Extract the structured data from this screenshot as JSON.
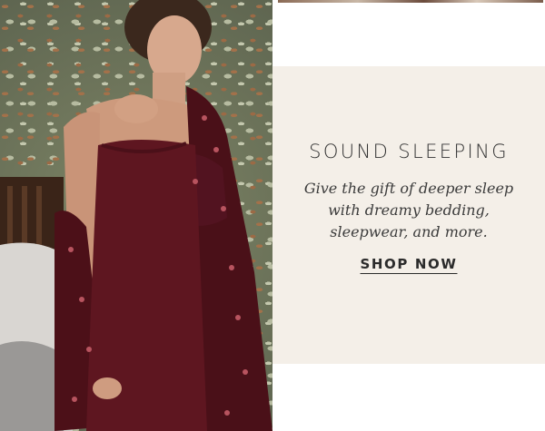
{
  "photo": {
    "subject": "woman in burgundy slip nightgown and floral robe",
    "background": "green leaf-print wallpaper"
  },
  "promo": {
    "title": "SOUND SLEEPING",
    "body": "Give the gift of deeper sleep with dreamy bedding, sleepwear, and more.",
    "cta_label": "SHOP NOW"
  },
  "colors": {
    "panel_background": "#f4efe8",
    "text": "#333333",
    "garment": "#5e1620"
  }
}
